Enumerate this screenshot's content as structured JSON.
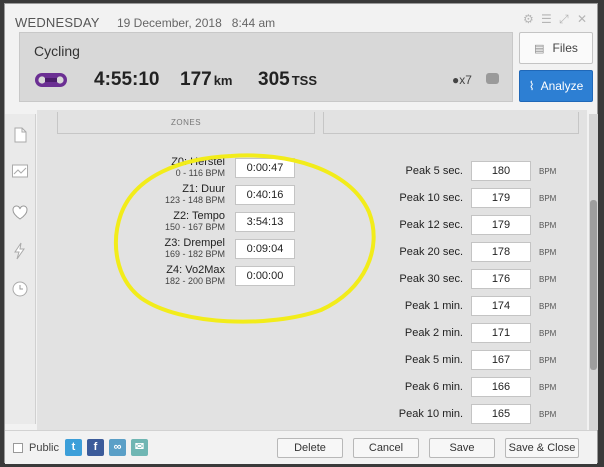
{
  "header": {
    "day": "WEDNESDAY",
    "date": "19 December, 2018",
    "time": "8:44 am",
    "sport": "Cycling",
    "duration": "4:55:10",
    "distance": "177",
    "distance_unit": "km",
    "tss": "305",
    "tss_unit": "TSS",
    "kettlebell_count": "x7",
    "files_label": "Files",
    "analyze_label": "Analyze"
  },
  "content": {
    "zones_tab_label": "ZONES",
    "zones": [
      {
        "name": "Z0: Herstel",
        "range": "0 - 116 BPM",
        "time": "0:00:47"
      },
      {
        "name": "Z1: Duur",
        "range": "123 - 148 BPM",
        "time": "0:40:16"
      },
      {
        "name": "Z2: Tempo",
        "range": "150 - 167 BPM",
        "time": "3:54:13"
      },
      {
        "name": "Z3: Drempel",
        "range": "169 - 182 BPM",
        "time": "0:09:04"
      },
      {
        "name": "Z4: Vo2Max",
        "range": "182 - 200 BPM",
        "time": "0:00:00"
      }
    ],
    "peak_unit": "BPM",
    "peaks": [
      {
        "label": "Peak 5 sec.",
        "value": "180"
      },
      {
        "label": "Peak 10 sec.",
        "value": "179"
      },
      {
        "label": "Peak 12 sec.",
        "value": "179"
      },
      {
        "label": "Peak 20 sec.",
        "value": "178"
      },
      {
        "label": "Peak 30 sec.",
        "value": "176"
      },
      {
        "label": "Peak 1 min.",
        "value": "174"
      },
      {
        "label": "Peak 2 min.",
        "value": "171"
      },
      {
        "label": "Peak 5 min.",
        "value": "167"
      },
      {
        "label": "Peak 6 min.",
        "value": "166"
      },
      {
        "label": "Peak 10 min.",
        "value": "165"
      }
    ]
  },
  "footer": {
    "public_label": "Public",
    "delete_label": "Delete",
    "cancel_label": "Cancel",
    "save_label": "Save",
    "save_close_label": "Save & Close"
  },
  "colors": {
    "accent": "#2d7fd3",
    "highlight_ellipse": "#f2ec1a",
    "chain_icon": "#6b2f93"
  }
}
